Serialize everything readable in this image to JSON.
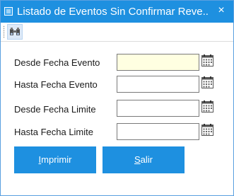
{
  "window": {
    "title": "Listado de Eventos Sin Confirmar Reve...",
    "close_label": "×"
  },
  "toolbar": {
    "items": [
      {
        "icon": "binoculars-icon"
      }
    ]
  },
  "form": {
    "fields": [
      {
        "label": "Desde Fecha Evento",
        "value": "",
        "focused": true
      },
      {
        "label": "Hasta Fecha Evento",
        "value": ""
      },
      {
        "label": "Desde Fecha Limite",
        "value": ""
      },
      {
        "label": "Hasta Fecha Limite",
        "value": ""
      }
    ],
    "calendar_icon": "calendar-icon"
  },
  "buttons": {
    "print": {
      "hotkey": "I",
      "rest": "mprimir"
    },
    "exit": {
      "hotkey": "S",
      "rest": "alir"
    }
  },
  "colors": {
    "accent": "#1e90e0",
    "focused_field": "#ffffe1"
  }
}
